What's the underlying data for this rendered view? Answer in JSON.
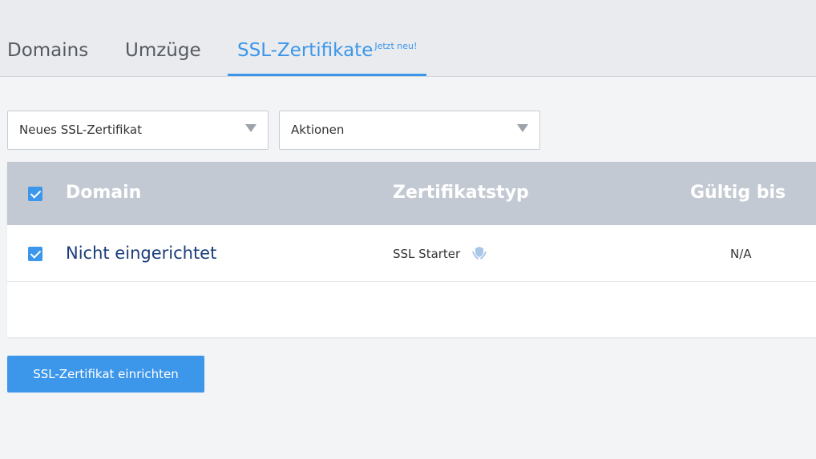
{
  "tabs": {
    "domains": "Domains",
    "umzuege": "Umzüge",
    "ssl": "SSL-Zertifikate",
    "ssl_badge": "Jetzt neu!"
  },
  "toolbar": {
    "new_ssl_select": "Neues SSL-Zertifikat",
    "actions_select": "Aktionen"
  },
  "table": {
    "headers": {
      "domain": "Domain",
      "type": "Zertifikatstyp",
      "valid_until": "Gültig bis"
    },
    "rows": [
      {
        "domain": "Nicht eingerichtet",
        "type": "SSL Starter",
        "type_icon": "shield-hands-icon",
        "valid_until": "N/A",
        "checked": true
      }
    ]
  },
  "actions": {
    "setup_button": "SSL-Zertifikat einrichten"
  },
  "colors": {
    "accent": "#3c96ea",
    "table_header_bg": "#c3c9d2",
    "link": "#1a3d7a"
  }
}
